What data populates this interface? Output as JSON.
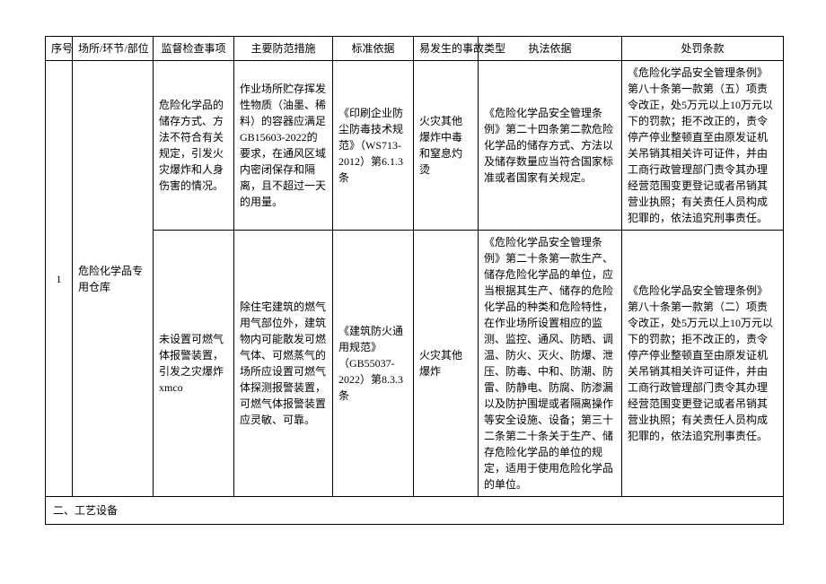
{
  "headers": {
    "seq": "序号",
    "place": "场所/环节/部位",
    "inspection": "监督检查事项",
    "measure": "主要防范措施",
    "basis": "标准依据",
    "type": "易发生的事故类型",
    "enforcement": "执法依据",
    "penalty": "处罚条款"
  },
  "rows": [
    {
      "seq": "1",
      "place": "危险化学品专用仓库",
      "sub": [
        {
          "inspection": "危险化学品的储存方式、方法不符合有关规定，引发火灾爆炸和人身伤害的情况。",
          "measure": "作业场所贮存挥发性物质（油墨、稀料）的容器应满足GB15603-2022的要求，在通风区域内密闭保存和隔离，且不超过一天的用量。",
          "basis": "《印刷企业防尘防毒技术规范》（WS713-2012）第6.1.3条",
          "type": "火灾其他爆炸中毒和窒息灼烫",
          "enforcement": "《危险化学品安全管理条例》第二十四条第二款危险化学品的储存方式、方法以及储存数量应当符合国家标准或者国家有关规定。",
          "penalty": "《危险化学品安全管理条例》第八十条第一款第（五）项责令改正，处5万元以上10万元以下的罚款；拒不改正的，责令停产停业整顿直至由原发证机关吊销其相关许可证件，并由工商行政管理部门责令其办理经营范围变更登记或者吊销其营业执照；有关责任人员构成犯罪的，依法追究刑事责任。"
        },
        {
          "inspection": "未设置可燃气体报警装置，引发之灾爆炸xmco",
          "measure": "除住宅建筑的燃气用气部位外，建筑物内可能散发可燃气体、可燃蒸气的场所应设置可燃气体探测报警装置，可燃气体报警装置应灵敏、可靠。",
          "basis": "《建筑防火通用规范》（GB55037-2022）第8.3.3条",
          "type": "火灾其他爆炸",
          "enforcement": "《危险化学品安全管理条例》第二十条第一款生产、储存危险化学品的单位，应当根据其生产、储存的危险化学品的种类和危险特性，在作业场所设置相应的监测、监控、通风、防晒、调温、防火、灭火、防爆、泄压、防毒、中和、防潮、防雷、防静电、防腐、防渗漏以及防护围堤或者隔离操作等安全设施、设备；第三十二条第二十条关于生产、储存危险化学品的单位的规定，适用于使用危险化学品的单位。",
          "penalty": "《危险化学品安全管理条例》第八十条第一款第（二）项责令改正，处5万元以上10万元以下的罚款；拒不改正的，责令停产停业整顿直至由原发证机关吊销其相关许可证件，并由工商行政管理部门责令其办理经营范围变更登记或者吊销其营业执照；有关责任人员构成犯罪的，依法追究刑事责任。"
        }
      ]
    }
  ],
  "section": "二、工艺设备"
}
